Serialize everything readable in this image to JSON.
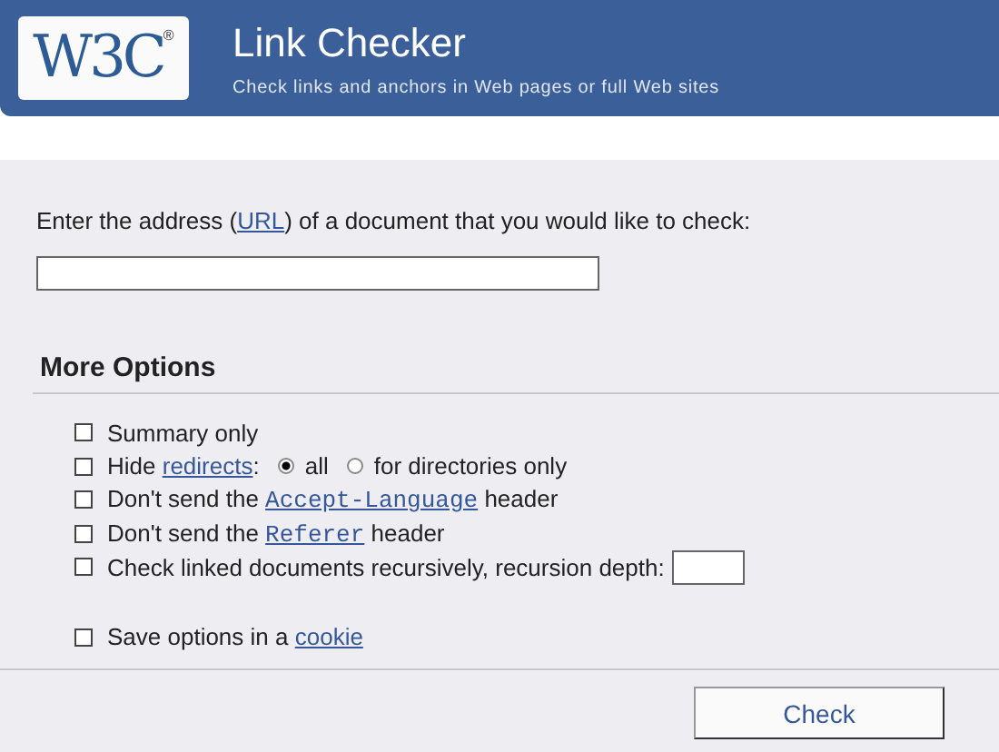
{
  "header": {
    "logo": "W3C",
    "logo_mark": "®",
    "title": "Link Checker",
    "subtitle": "Check links and anchors in Web pages or full Web sites"
  },
  "form": {
    "prompt": [
      {
        "kind": "text",
        "text": "Enter the address ("
      },
      {
        "kind": "link",
        "text": "URL"
      },
      {
        "kind": "text",
        "text": ") of a document that you would like to check:"
      }
    ],
    "options_title": "More Options",
    "options": [
      {
        "checked": false,
        "parts": [
          {
            "kind": "text",
            "text": "Summary only"
          }
        ]
      },
      {
        "checked": false,
        "parts": [
          {
            "kind": "text",
            "text": "Hide "
          },
          {
            "kind": "link",
            "text": "redirects"
          },
          {
            "kind": "text",
            "text": ":"
          },
          {
            "kind": "radio",
            "text": "all",
            "selected": true
          },
          {
            "kind": "radio",
            "text": "for directories only",
            "selected": false
          }
        ]
      },
      {
        "checked": false,
        "parts": [
          {
            "kind": "text",
            "text": "Don't send the "
          },
          {
            "kind": "code",
            "text": "Accept-Language"
          },
          {
            "kind": "text",
            "text": " header"
          }
        ]
      },
      {
        "checked": false,
        "parts": [
          {
            "kind": "text",
            "text": "Don't send the "
          },
          {
            "kind": "code",
            "text": "Referer"
          },
          {
            "kind": "text",
            "text": " header"
          }
        ]
      },
      {
        "checked": false,
        "parts": [
          {
            "kind": "text",
            "text": "Check linked documents recursively, recursion depth:"
          },
          {
            "kind": "field"
          }
        ]
      },
      {
        "checked": false,
        "gap": true,
        "parts": [
          {
            "kind": "text",
            "text": "Save options in a "
          },
          {
            "kind": "link",
            "text": "cookie"
          }
        ]
      }
    ],
    "submit": "Check"
  }
}
